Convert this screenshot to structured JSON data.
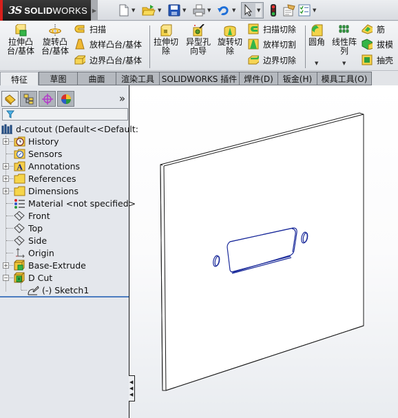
{
  "app": {
    "brand_ds": "3S",
    "brand_solid": "SOLID",
    "brand_works": "WORKS"
  },
  "toolbar": {
    "items": [
      {
        "name": "new-document",
        "icon": "new-document-icon",
        "has_dropdown": true
      },
      {
        "name": "open",
        "icon": "open-folder-icon",
        "has_dropdown": true
      },
      {
        "name": "save",
        "icon": "save-disk-icon",
        "has_dropdown": true
      },
      {
        "name": "print",
        "icon": "printer-icon",
        "has_dropdown": true
      },
      {
        "name": "undo",
        "icon": "undo-arrow-icon",
        "has_dropdown": true
      },
      {
        "name": "select",
        "icon": "cursor-arrow-icon",
        "has_dropdown": true,
        "active": true
      },
      {
        "name": "rebuild",
        "icon": "traffic-light-icon",
        "has_dropdown": false
      },
      {
        "name": "file-properties",
        "icon": "file-properties-icon",
        "has_dropdown": false
      },
      {
        "name": "options",
        "icon": "options-checklist-icon",
        "has_dropdown": true
      }
    ]
  },
  "ribbon": {
    "big_buttons": [
      {
        "id": "extrude-boss",
        "line1": "拉伸凸",
        "line2": "台/基体"
      },
      {
        "id": "revolve-boss",
        "line1": "旋转凸",
        "line2": "台/基体"
      },
      {
        "id": "extrude-cut",
        "line1": "拉伸切",
        "line2": "除"
      },
      {
        "id": "hole-wizard",
        "line1": "异型孔",
        "line2": "向导"
      },
      {
        "id": "revolve-cut",
        "line1": "旋转切",
        "line2": "除"
      },
      {
        "id": "fillet",
        "line1": "圆角",
        "line2": ""
      },
      {
        "id": "linear-pattern",
        "line1": "线性阵",
        "line2": "列"
      }
    ],
    "small_buttons": [
      {
        "id": "sweep",
        "label": "扫描"
      },
      {
        "id": "loft-boss",
        "label": "放样凸台/基体"
      },
      {
        "id": "boundary-boss",
        "label": "边界凸台/基体"
      },
      {
        "id": "sweep-cut",
        "label": "扫描切除"
      },
      {
        "id": "loft-cut",
        "label": "放样切割"
      },
      {
        "id": "boundary-cut",
        "label": "边界切除"
      },
      {
        "id": "rib",
        "label": "筋"
      },
      {
        "id": "draft",
        "label": "拔模"
      },
      {
        "id": "shell",
        "label": "抽壳"
      }
    ]
  },
  "tabs": [
    {
      "label": "特征",
      "active": true
    },
    {
      "label": "草图",
      "active": false
    },
    {
      "label": "曲面",
      "active": false
    },
    {
      "label": "渲染工具",
      "active": false
    },
    {
      "label": "SOLIDWORKS 插件",
      "active": false
    },
    {
      "label": "焊件(D)",
      "active": false
    },
    {
      "label": "钣金(H)",
      "active": false
    },
    {
      "label": "模具工具(O)",
      "active": false
    }
  ],
  "panel": {
    "tabs": [
      {
        "name": "feature-manager",
        "icon": "feature-manager-icon",
        "active": true
      },
      {
        "name": "property-manager",
        "icon": "property-manager-icon",
        "active": false
      },
      {
        "name": "configuration-manager",
        "icon": "configuration-manager-icon",
        "active": false
      },
      {
        "name": "display-manager",
        "icon": "display-manager-icon",
        "active": false
      }
    ],
    "more_label": "»",
    "filter_icon": "filter-funnel-icon"
  },
  "tree": {
    "root": {
      "label": "d-cutout  (Default<<Default:",
      "icon": "part-icon"
    },
    "items": [
      {
        "label": "History",
        "icon": "history-folder-icon",
        "expandable": true
      },
      {
        "label": "Sensors",
        "icon": "sensors-folder-icon",
        "expandable": false
      },
      {
        "label": "Annotations",
        "icon": "annotations-icon",
        "expandable": true
      },
      {
        "label": "References",
        "icon": "folder-icon",
        "expandable": true
      },
      {
        "label": "Dimensions",
        "icon": "folder-icon",
        "expandable": true
      },
      {
        "label": "Material <not specified>",
        "icon": "material-icon",
        "expandable": false
      },
      {
        "label": "Front",
        "icon": "plane-icon",
        "expandable": false
      },
      {
        "label": "Top",
        "icon": "plane-icon",
        "expandable": false
      },
      {
        "label": "Side",
        "icon": "plane-icon",
        "expandable": false
      },
      {
        "label": "Origin",
        "icon": "origin-icon",
        "expandable": false
      },
      {
        "label": "Base-Extrude",
        "icon": "extrude-feature-icon",
        "expandable": true,
        "expanded": false
      },
      {
        "label": "D Cut",
        "icon": "cut-feature-icon",
        "expandable": true,
        "expanded": true
      },
      {
        "label": "(-) Sketch1",
        "icon": "sketch-icon",
        "expandable": false,
        "child": true
      }
    ]
  },
  "colors": {
    "edge": "#1a1a1a",
    "cut_edge": "#1a2a9a",
    "tree_separator": "#4b7cc0"
  }
}
